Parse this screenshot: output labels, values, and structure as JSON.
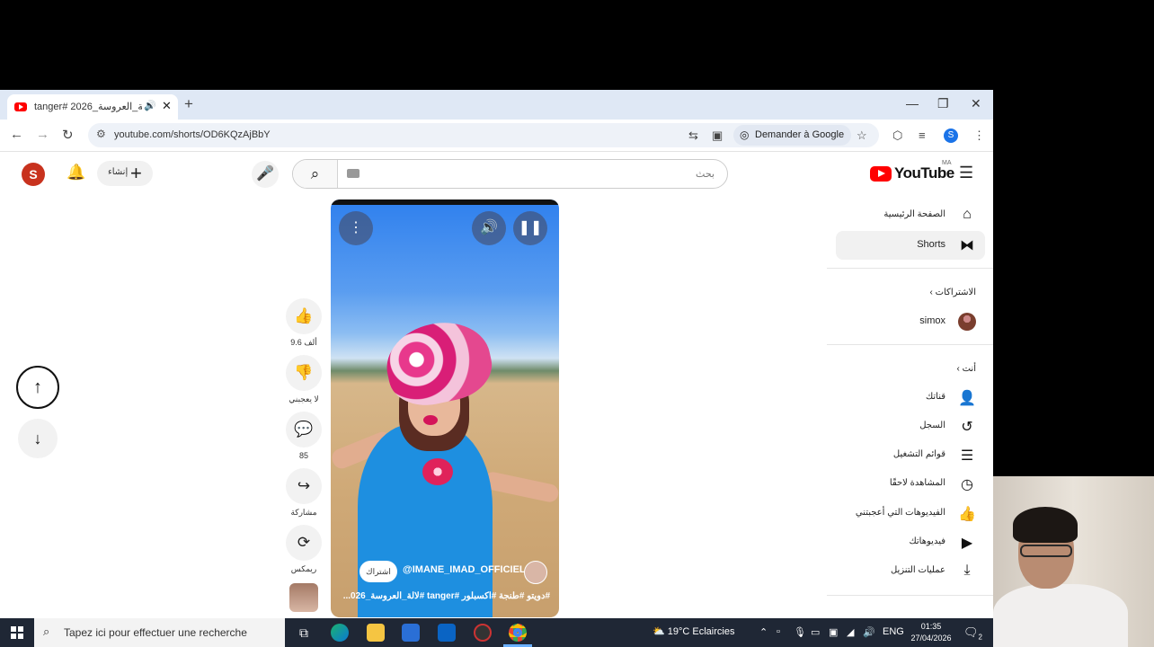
{
  "browser": {
    "tab_title": "tanger# 2026_لالة_العروسة#",
    "tab_close": "✕",
    "new_tab": "+",
    "window_min": "—",
    "window_restore": "❐",
    "window_close": "✕",
    "url": "youtube.com/shorts/OD6KQzAjBbY",
    "ask_google": "Demander à Google",
    "profile_initial": "S"
  },
  "yt": {
    "avatar_initial": "S",
    "create_label": "إنشاء",
    "search_placeholder": "بحث",
    "logo_text": "YouTube",
    "country_code": "MA"
  },
  "video": {
    "subscribe": "اشتراك",
    "channel": "@IMANE_IMAD_OFFICIEL",
    "title": "#دويتو #طنجة #اكسبلور #tanger #لالة_العروسة_026..."
  },
  "actions": {
    "likes": "9.6 ألف",
    "dislike": "لا يعجبني",
    "comments": "85",
    "share": "مشاركة",
    "remix": "ريمكس"
  },
  "sidebar": {
    "home": "الصفحة الرئيسية",
    "shorts": "Shorts",
    "subscriptions_header": "الاشتراكات",
    "sub_channel": "simox",
    "you_header": "أنت",
    "your_channel": "قناتك",
    "history": "السجل",
    "playlists": "قوائم التشغيل",
    "watch_later": "المشاهدة لاحقًا",
    "liked_videos": "الفيديوهات التي أعجبتني",
    "your_videos": "فيديوهاتك",
    "downloads": "عمليات التنزيل"
  },
  "taskbar": {
    "search_placeholder": "Tapez ici pour effectuer une recherche",
    "weather": "19°C  Eclaircies",
    "lang": "ENG",
    "time": "01:35",
    "date": "27/04/2026",
    "notif_count": "2"
  }
}
